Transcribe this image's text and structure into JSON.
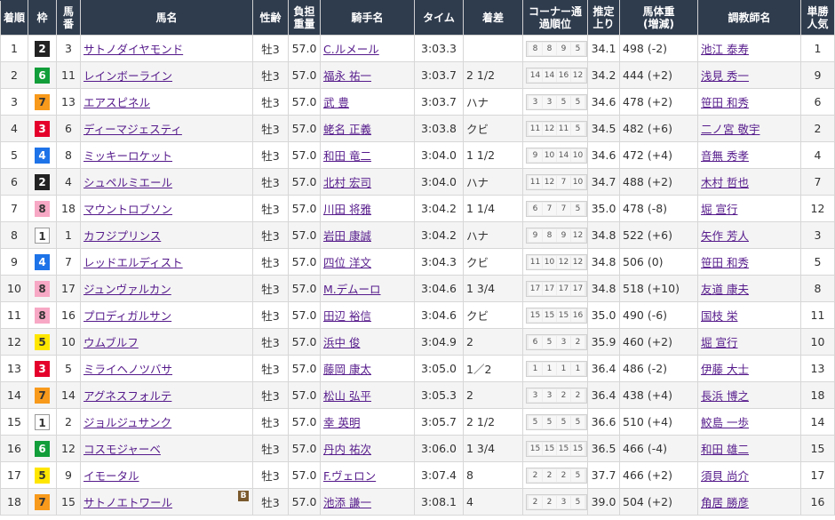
{
  "colors": {
    "header_bg": "#2f3c4e",
    "waku_1": {
      "bg": "#ffffff",
      "fg": "#333333",
      "border": "#999999"
    },
    "waku_2": {
      "bg": "#222222",
      "fg": "#ffffff"
    },
    "waku_3": {
      "bg": "#e4002b",
      "fg": "#ffffff"
    },
    "waku_4": {
      "bg": "#1e73e8",
      "fg": "#ffffff"
    },
    "waku_5": {
      "bg": "#ffe600",
      "fg": "#333333"
    },
    "waku_6": {
      "bg": "#129e3a",
      "fg": "#ffffff"
    },
    "waku_7": {
      "bg": "#f89a1c",
      "fg": "#333333"
    },
    "waku_8": {
      "bg": "#f7a8c4",
      "fg": "#333333"
    }
  },
  "headers": [
    "着順",
    "枠",
    "馬番",
    "馬名",
    "性齢",
    "負担重量",
    "騎手名",
    "タイム",
    "着差",
    "コーナー通過順位",
    "推定上り",
    "馬体重(増減)",
    "調教師名",
    "単勝人気"
  ],
  "rows": [
    {
      "rank": "1",
      "waku": "2",
      "num": "3",
      "horse": "サトノダイヤモンド",
      "sexage": "牡3",
      "weight": "57.0",
      "jockey": "C.ルメール",
      "time": "3:03.3",
      "margin": "",
      "corners": [
        "8",
        "8",
        "9",
        "5"
      ],
      "last3f": "34.1",
      "body": "498 (-2)",
      "trainer": "池江 泰寿",
      "pop": "1",
      "blinker": ""
    },
    {
      "rank": "2",
      "waku": "6",
      "num": "11",
      "horse": "レインボーライン",
      "sexage": "牡3",
      "weight": "57.0",
      "jockey": "福永 祐一",
      "time": "3:03.7",
      "margin": "2 1/2",
      "corners": [
        "14",
        "14",
        "16",
        "12"
      ],
      "last3f": "34.2",
      "body": "444 (+2)",
      "trainer": "浅見 秀一",
      "pop": "9",
      "blinker": ""
    },
    {
      "rank": "3",
      "waku": "7",
      "num": "13",
      "horse": "エアスピネル",
      "sexage": "牡3",
      "weight": "57.0",
      "jockey": "武 豊",
      "time": "3:03.7",
      "margin": "ハナ",
      "corners": [
        "3",
        "3",
        "5",
        "5"
      ],
      "last3f": "34.6",
      "body": "478 (+2)",
      "trainer": "笹田 和秀",
      "pop": "6",
      "blinker": ""
    },
    {
      "rank": "4",
      "waku": "3",
      "num": "6",
      "horse": "ディーマジェスティ",
      "sexage": "牡3",
      "weight": "57.0",
      "jockey": "蛯名 正義",
      "time": "3:03.8",
      "margin": "クビ",
      "corners": [
        "11",
        "12",
        "11",
        "5"
      ],
      "last3f": "34.5",
      "body": "482 (+6)",
      "trainer": "二ノ宮 敬宇",
      "pop": "2",
      "blinker": ""
    },
    {
      "rank": "5",
      "waku": "4",
      "num": "8",
      "horse": "ミッキーロケット",
      "sexage": "牡3",
      "weight": "57.0",
      "jockey": "和田 竜二",
      "time": "3:04.0",
      "margin": "1 1/2",
      "corners": [
        "9",
        "10",
        "14",
        "10"
      ],
      "last3f": "34.6",
      "body": "472 (+4)",
      "trainer": "音無 秀孝",
      "pop": "4",
      "blinker": ""
    },
    {
      "rank": "6",
      "waku": "2",
      "num": "4",
      "horse": "シュペルミエール",
      "sexage": "牡3",
      "weight": "57.0",
      "jockey": "北村 宏司",
      "time": "3:04.0",
      "margin": "ハナ",
      "corners": [
        "11",
        "12",
        "7",
        "10"
      ],
      "last3f": "34.7",
      "body": "488 (+2)",
      "trainer": "木村 哲也",
      "pop": "7",
      "blinker": ""
    },
    {
      "rank": "7",
      "waku": "8",
      "num": "18",
      "horse": "マウントロブソン",
      "sexage": "牡3",
      "weight": "57.0",
      "jockey": "川田 将雅",
      "time": "3:04.2",
      "margin": "1 1/4",
      "corners": [
        "6",
        "7",
        "7",
        "5"
      ],
      "last3f": "35.0",
      "body": "478 (-8)",
      "trainer": "堀 宣行",
      "pop": "12",
      "blinker": ""
    },
    {
      "rank": "8",
      "waku": "1",
      "num": "1",
      "horse": "カフジプリンス",
      "sexage": "牡3",
      "weight": "57.0",
      "jockey": "岩田 康誠",
      "time": "3:04.2",
      "margin": "ハナ",
      "corners": [
        "9",
        "8",
        "9",
        "12"
      ],
      "last3f": "34.8",
      "body": "522 (+6)",
      "trainer": "矢作 芳人",
      "pop": "3",
      "blinker": ""
    },
    {
      "rank": "9",
      "waku": "4",
      "num": "7",
      "horse": "レッドエルディスト",
      "sexage": "牡3",
      "weight": "57.0",
      "jockey": "四位 洋文",
      "time": "3:04.3",
      "margin": "クビ",
      "corners": [
        "11",
        "10",
        "12",
        "12"
      ],
      "last3f": "34.8",
      "body": "506 (0)",
      "trainer": "笹田 和秀",
      "pop": "5",
      "blinker": ""
    },
    {
      "rank": "10",
      "waku": "8",
      "num": "17",
      "horse": "ジュンヴァルカン",
      "sexage": "牡3",
      "weight": "57.0",
      "jockey": "M.デムーロ",
      "time": "3:04.6",
      "margin": "1 3/4",
      "corners": [
        "17",
        "17",
        "17",
        "17"
      ],
      "last3f": "34.8",
      "body": "518 (+10)",
      "trainer": "友道 康夫",
      "pop": "8",
      "blinker": ""
    },
    {
      "rank": "11",
      "waku": "8",
      "num": "16",
      "horse": "プロディガルサン",
      "sexage": "牡3",
      "weight": "57.0",
      "jockey": "田辺 裕信",
      "time": "3:04.6",
      "margin": "クビ",
      "corners": [
        "15",
        "15",
        "15",
        "16"
      ],
      "last3f": "35.0",
      "body": "490 (-6)",
      "trainer": "国枝 栄",
      "pop": "11",
      "blinker": ""
    },
    {
      "rank": "12",
      "waku": "5",
      "num": "10",
      "horse": "ウムブルフ",
      "sexage": "牡3",
      "weight": "57.0",
      "jockey": "浜中 俊",
      "time": "3:04.9",
      "margin": "2",
      "corners": [
        "6",
        "5",
        "3",
        "2"
      ],
      "last3f": "35.9",
      "body": "460 (+2)",
      "trainer": "堀 宣行",
      "pop": "10",
      "blinker": ""
    },
    {
      "rank": "13",
      "waku": "3",
      "num": "5",
      "horse": "ミライヘノツバサ",
      "sexage": "牡3",
      "weight": "57.0",
      "jockey": "藤岡 康太",
      "time": "3:05.0",
      "margin": "1／2",
      "corners": [
        "1",
        "1",
        "1",
        "1"
      ],
      "last3f": "36.4",
      "body": "486 (-2)",
      "trainer": "伊藤 大士",
      "pop": "13",
      "blinker": ""
    },
    {
      "rank": "14",
      "waku": "7",
      "num": "14",
      "horse": "アグネスフォルテ",
      "sexage": "牡3",
      "weight": "57.0",
      "jockey": "松山 弘平",
      "time": "3:05.3",
      "margin": "2",
      "corners": [
        "3",
        "3",
        "2",
        "2"
      ],
      "last3f": "36.4",
      "body": "438 (+4)",
      "trainer": "長浜 博之",
      "pop": "18",
      "blinker": ""
    },
    {
      "rank": "15",
      "waku": "1",
      "num": "2",
      "horse": "ジョルジュサンク",
      "sexage": "牡3",
      "weight": "57.0",
      "jockey": "幸 英明",
      "time": "3:05.7",
      "margin": "2 1/2",
      "corners": [
        "5",
        "5",
        "5",
        "5"
      ],
      "last3f": "36.6",
      "body": "510 (+4)",
      "trainer": "鮫島 一歩",
      "pop": "14",
      "blinker": ""
    },
    {
      "rank": "16",
      "waku": "6",
      "num": "12",
      "horse": "コスモジャーベ",
      "sexage": "牡3",
      "weight": "57.0",
      "jockey": "丹内 祐次",
      "time": "3:06.0",
      "margin": "1 3/4",
      "corners": [
        "15",
        "15",
        "15",
        "15"
      ],
      "last3f": "36.5",
      "body": "466 (-4)",
      "trainer": "和田 雄二",
      "pop": "15",
      "blinker": ""
    },
    {
      "rank": "17",
      "waku": "5",
      "num": "9",
      "horse": "イモータル",
      "sexage": "牡3",
      "weight": "57.0",
      "jockey": "F.ヴェロン",
      "time": "3:07.4",
      "margin": "8",
      "corners": [
        "2",
        "2",
        "2",
        "5"
      ],
      "last3f": "37.7",
      "body": "466 (+2)",
      "trainer": "須貝 尚介",
      "pop": "17",
      "blinker": ""
    },
    {
      "rank": "18",
      "waku": "7",
      "num": "15",
      "horse": "サトノエトワール",
      "sexage": "牡3",
      "weight": "57.0",
      "jockey": "池添 謙一",
      "time": "3:08.1",
      "margin": "4",
      "corners": [
        "2",
        "2",
        "3",
        "5"
      ],
      "last3f": "39.0",
      "body": "504 (+2)",
      "trainer": "角居 勝彦",
      "pop": "16",
      "blinker": "B"
    }
  ]
}
